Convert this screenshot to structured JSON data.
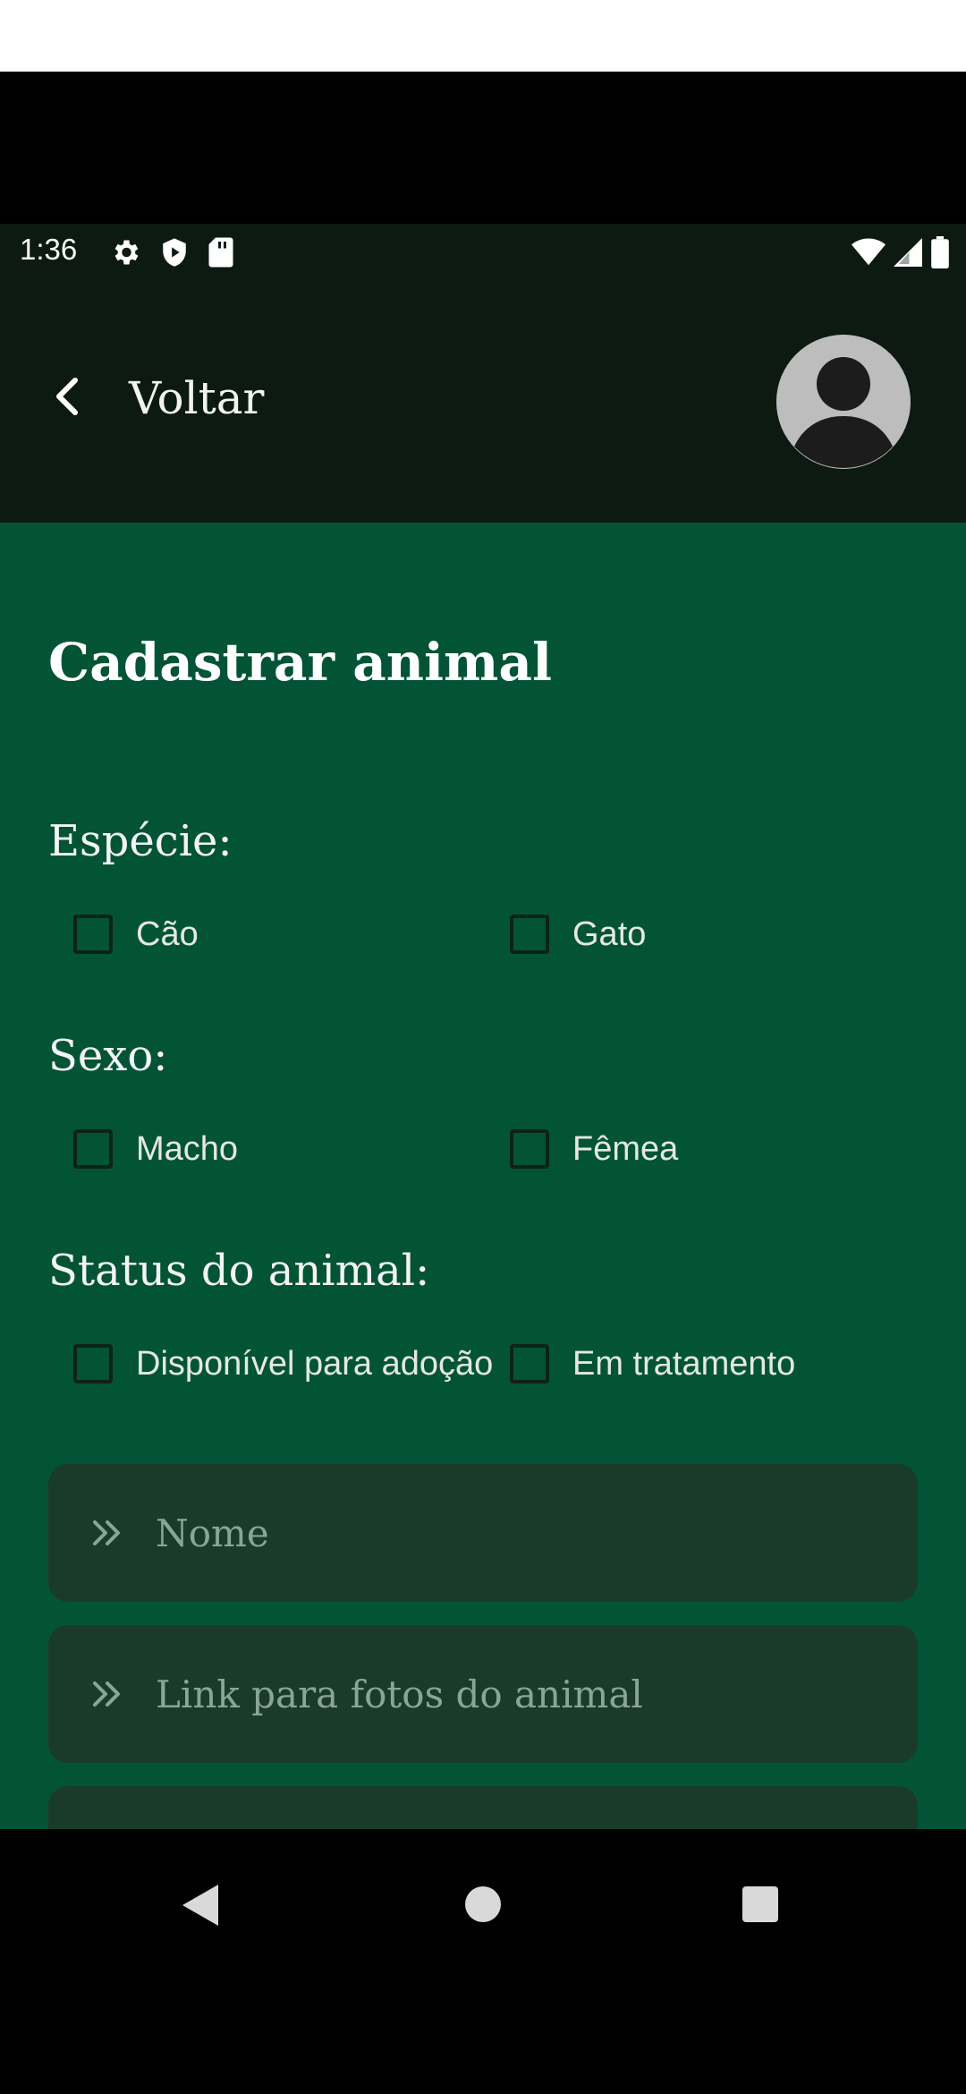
{
  "status_bar": {
    "time": "1:36",
    "left_icons": [
      "settings-icon",
      "shield-play-icon",
      "sd-card-icon"
    ],
    "right_icons": [
      "wifi-icon",
      "signal-icon",
      "battery-icon"
    ]
  },
  "app_bar": {
    "back_label": "Voltar",
    "avatar_icon": "account-circle-icon"
  },
  "form": {
    "title": "Cadastrar animal",
    "especie": {
      "label": "Espécie:",
      "options": [
        "Cão",
        "Gato"
      ]
    },
    "sexo": {
      "label": "Sexo:",
      "options": [
        "Macho",
        "Fêmea"
      ]
    },
    "status": {
      "label": "Status do animal:",
      "options": [
        "Disponível para adoção",
        "Em tratamento"
      ]
    },
    "fields": [
      {
        "placeholder": "Nome",
        "icon": "double-chevron-right-icon"
      },
      {
        "placeholder": "Link para fotos do animal",
        "icon": "double-chevron-right-icon"
      }
    ]
  },
  "colors": {
    "content_bg": "#035436",
    "app_bar_bg": "#0c1a12",
    "field_bg": "#1a3b2a"
  },
  "nav_bar": {
    "buttons": [
      "back-triangle-icon",
      "home-circle-icon",
      "recents-square-icon"
    ]
  }
}
